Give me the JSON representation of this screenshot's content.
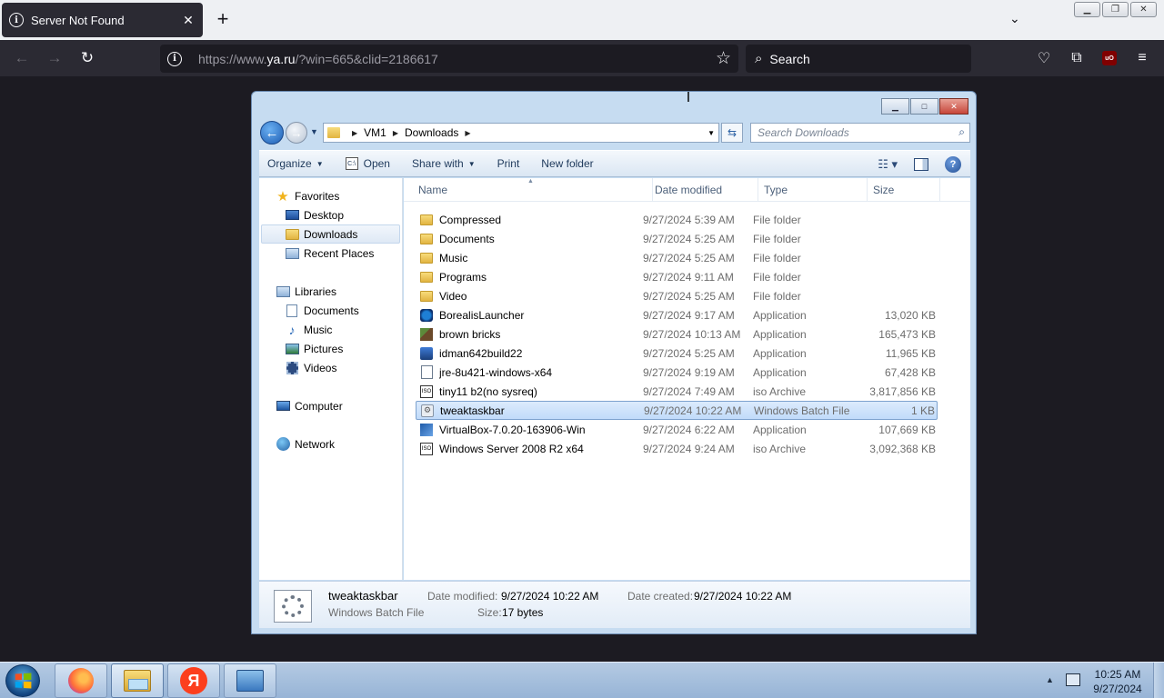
{
  "browser": {
    "tab": {
      "title": "Server Not Found",
      "close": "✕"
    },
    "new_tab": "+",
    "url_scheme_path_prefix": "https://www.",
    "url_host": "ya.ru",
    "url_rest": "/?win=665&clid=2186617",
    "search_placeholder": "Search"
  },
  "explorer": {
    "breadcrumb": [
      "VM1",
      "Downloads"
    ],
    "search_placeholder": "Search Downloads",
    "commands": {
      "organize": "Organize",
      "open": "Open",
      "share_with": "Share with",
      "print": "Print",
      "new_folder": "New folder"
    },
    "nav": {
      "favorites": "Favorites",
      "desktop": "Desktop",
      "downloads": "Downloads",
      "recent_places": "Recent Places",
      "libraries": "Libraries",
      "documents": "Documents",
      "music": "Music",
      "pictures": "Pictures",
      "videos": "Videos",
      "computer": "Computer",
      "network": "Network"
    },
    "columns": {
      "name": "Name",
      "date": "Date modified",
      "type": "Type",
      "size": "Size"
    },
    "files": [
      {
        "name": "Compressed",
        "date": "9/27/2024 5:39 AM",
        "type": "File folder",
        "size": "",
        "icon": "folder-icon"
      },
      {
        "name": "Documents",
        "date": "9/27/2024 5:25 AM",
        "type": "File folder",
        "size": "",
        "icon": "folder-icon"
      },
      {
        "name": "Music",
        "date": "9/27/2024 5:25 AM",
        "type": "File folder",
        "size": "",
        "icon": "folder-icon"
      },
      {
        "name": "Programs",
        "date": "9/27/2024 9:11 AM",
        "type": "File folder",
        "size": "",
        "icon": "folder-icon"
      },
      {
        "name": "Video",
        "date": "9/27/2024 5:25 AM",
        "type": "File folder",
        "size": "",
        "icon": "folder-icon"
      },
      {
        "name": "BorealisLauncher",
        "date": "9/27/2024 9:17 AM",
        "type": "Application",
        "size": "13,020 KB",
        "icon": "borealis-app-icon"
      },
      {
        "name": "brown bricks",
        "date": "9/27/2024 10:13 AM",
        "type": "Application",
        "size": "165,473 KB",
        "icon": "minecraft-app-icon"
      },
      {
        "name": "idman642build22",
        "date": "9/27/2024 5:25 AM",
        "type": "Application",
        "size": "11,965 KB",
        "icon": "idm-app-icon"
      },
      {
        "name": "jre-8u421-windows-x64",
        "date": "9/27/2024 9:19 AM",
        "type": "Application",
        "size": "67,428 KB",
        "icon": "java-app-icon"
      },
      {
        "name": "tiny11 b2(no sysreq)",
        "date": "9/27/2024 7:49 AM",
        "type": "iso Archive",
        "size": "3,817,856 KB",
        "icon": "iso-icon"
      },
      {
        "name": "tweaktaskbar",
        "date": "9/27/2024 10:22 AM",
        "type": "Windows Batch File",
        "size": "1 KB",
        "icon": "batch-file-icon"
      },
      {
        "name": "VirtualBox-7.0.20-163906-Win",
        "date": "9/27/2024 6:22 AM",
        "type": "Application",
        "size": "107,669 KB",
        "icon": "virtualbox-app-icon"
      },
      {
        "name": "Windows Server 2008 R2 x64",
        "date": "9/27/2024 9:24 AM",
        "type": "iso Archive",
        "size": "3,092,368 KB",
        "icon": "iso-icon"
      }
    ],
    "selected_index": 10,
    "details": {
      "name": "tweaktaskbar",
      "type": "Windows Batch File",
      "date_modified_label": "Date modified:",
      "date_modified": "9/27/2024 10:22 AM",
      "date_created_label": "Date created:",
      "date_created": "9/27/2024 10:22 AM",
      "size_label": "Size:",
      "size": "17 bytes"
    }
  },
  "taskbar": {
    "yandex_letter": "Я",
    "clock_time": "10:25 AM",
    "clock_date": "9/27/2024"
  }
}
